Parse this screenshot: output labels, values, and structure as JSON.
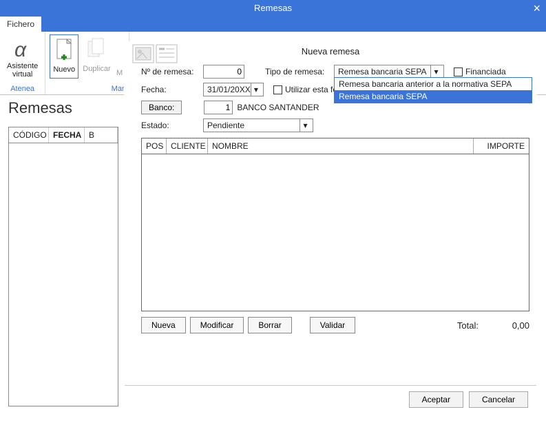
{
  "window": {
    "title": "Remesas",
    "close": "×"
  },
  "menu": {
    "fichero": "Fichero"
  },
  "ribbon": {
    "group1_caption": "Atenea",
    "group2_caption": "Mar",
    "asistente": "Asistente\nvirtual",
    "nuevo": "Nuevo",
    "duplicar": "Duplicar",
    "m": "M"
  },
  "page": {
    "title": "Remesas"
  },
  "back_grid": {
    "col_codigo": "CÓDIGO",
    "col_fecha": "FECHA",
    "col_b": "B"
  },
  "dialog": {
    "title": "Nueva remesa",
    "labels": {
      "n_remesa": "Nº de remesa:",
      "tipo": "Tipo de remesa:",
      "financiada": "Financiada",
      "fecha": "Fecha:",
      "utilizar": "Utilizar esta fe",
      "banco": "Banco:",
      "estado": "Estado:"
    },
    "values": {
      "n_remesa": "0",
      "tipo": "Remesa bancaria SEPA",
      "fecha": "31/01/20XX",
      "banco_code": "1",
      "banco_name": "BANCO SANTANDER",
      "estado": "Pendiente"
    },
    "tipo_options": [
      "Remesa bancaria anterior a la normativa SEPA",
      "Remesa bancaria SEPA"
    ],
    "tipo_selected_index": 1,
    "detail_columns": {
      "pos": "POS",
      "cliente": "CLIENTE",
      "nombre": "NOMBRE",
      "importe": "IMPORTE"
    },
    "buttons": {
      "nueva": "Nueva",
      "modificar": "Modificar",
      "borrar": "Borrar",
      "validar": "Validar"
    },
    "total_label": "Total:",
    "total_value": "0,00",
    "footer": {
      "aceptar": "Aceptar",
      "cancelar": "Cancelar"
    }
  }
}
